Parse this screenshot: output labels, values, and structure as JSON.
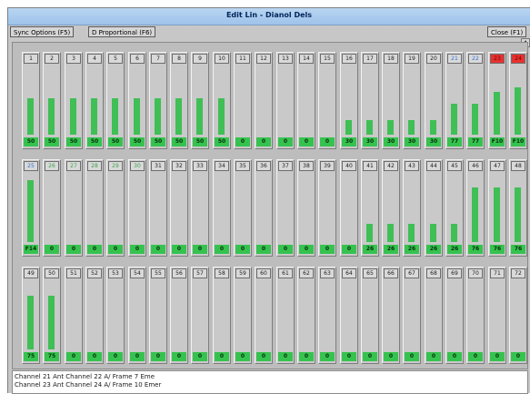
{
  "window": {
    "title": "Edit Lin - Dianol Dels"
  },
  "toolbar": {
    "left_button": "Sync Options (F5)",
    "middle_button": "D Proportional (F6)",
    "right_button": "Close (F1)",
    "scroll_glyph": "▲"
  },
  "colors": {
    "bar": "#3fbf55",
    "value_box": "#36c24f",
    "alarm": "#e5312e",
    "blue_label": "#2f6fd8",
    "green_label": "#3ca24b"
  },
  "channels": [
    {
      "label": "1",
      "value": "50",
      "level": 0.55,
      "label_color": "normal"
    },
    {
      "label": "2",
      "value": "50",
      "level": 0.55,
      "label_color": "normal"
    },
    {
      "label": "3",
      "value": "50",
      "level": 0.55,
      "label_color": "normal"
    },
    {
      "label": "4",
      "value": "50",
      "level": 0.55,
      "label_color": "normal"
    },
    {
      "label": "5",
      "value": "50",
      "level": 0.55,
      "label_color": "normal"
    },
    {
      "label": "6",
      "value": "50",
      "level": 0.55,
      "label_color": "normal"
    },
    {
      "label": "7",
      "value": "50",
      "level": 0.55,
      "label_color": "normal"
    },
    {
      "label": "8",
      "value": "50",
      "level": 0.55,
      "label_color": "normal"
    },
    {
      "label": "9",
      "value": "50",
      "level": 0.55,
      "label_color": "normal"
    },
    {
      "label": "10",
      "value": "50",
      "level": 0.55,
      "label_color": "normal"
    },
    {
      "label": "11",
      "value": "0",
      "level": 0,
      "label_color": "normal"
    },
    {
      "label": "12",
      "value": "0",
      "level": 0,
      "label_color": "normal"
    },
    {
      "label": "13",
      "value": "0",
      "level": 0,
      "label_color": "normal"
    },
    {
      "label": "14",
      "value": "0",
      "level": 0,
      "label_color": "normal"
    },
    {
      "label": "15",
      "value": "0",
      "level": 0,
      "label_color": "normal"
    },
    {
      "label": "16",
      "value": "30",
      "level": 0.22,
      "label_color": "normal"
    },
    {
      "label": "17",
      "value": "30",
      "level": 0.22,
      "label_color": "normal"
    },
    {
      "label": "18",
      "value": "30",
      "level": 0.22,
      "label_color": "normal"
    },
    {
      "label": "19",
      "value": "30",
      "level": 0.22,
      "label_color": "normal"
    },
    {
      "label": "20",
      "value": "30",
      "level": 0.22,
      "label_color": "normal"
    },
    {
      "label": "21",
      "value": "77",
      "level": 0.47,
      "label_color": "blue"
    },
    {
      "label": "22",
      "value": "77",
      "level": 0.47,
      "label_color": "blue"
    },
    {
      "label": "23",
      "value": "F10",
      "level": 0.65,
      "label_color": "red"
    },
    {
      "label": "24",
      "value": "F10",
      "level": 0.72,
      "label_color": "red"
    },
    {
      "label": "25",
      "value": "F14",
      "level": 0.95,
      "label_color": "blue"
    },
    {
      "label": "26",
      "value": "0",
      "level": 0,
      "label_color": "green"
    },
    {
      "label": "27",
      "value": "0",
      "level": 0,
      "label_color": "green"
    },
    {
      "label": "28",
      "value": "0",
      "level": 0,
      "label_color": "green"
    },
    {
      "label": "29",
      "value": "0",
      "level": 0,
      "label_color": "green"
    },
    {
      "label": "30",
      "value": "0",
      "level": 0,
      "label_color": "green"
    },
    {
      "label": "31",
      "value": "0",
      "level": 0,
      "label_color": "normal"
    },
    {
      "label": "32",
      "value": "0",
      "level": 0,
      "label_color": "normal"
    },
    {
      "label": "33",
      "value": "0",
      "level": 0,
      "label_color": "normal"
    },
    {
      "label": "34",
      "value": "0",
      "level": 0,
      "label_color": "normal"
    },
    {
      "label": "35",
      "value": "0",
      "level": 0,
      "label_color": "normal"
    },
    {
      "label": "36",
      "value": "0",
      "level": 0,
      "label_color": "normal"
    },
    {
      "label": "37",
      "value": "0",
      "level": 0,
      "label_color": "normal"
    },
    {
      "label": "38",
      "value": "0",
      "level": 0,
      "label_color": "normal"
    },
    {
      "label": "39",
      "value": "0",
      "level": 0,
      "label_color": "normal"
    },
    {
      "label": "40",
      "value": "0",
      "level": 0,
      "label_color": "normal"
    },
    {
      "label": "41",
      "value": "26",
      "level": 0.28,
      "label_color": "normal"
    },
    {
      "label": "42",
      "value": "26",
      "level": 0.28,
      "label_color": "normal"
    },
    {
      "label": "43",
      "value": "26",
      "level": 0.28,
      "label_color": "normal"
    },
    {
      "label": "44",
      "value": "26",
      "level": 0.28,
      "label_color": "normal"
    },
    {
      "label": "45",
      "value": "26",
      "level": 0.28,
      "label_color": "normal"
    },
    {
      "label": "46",
      "value": "76",
      "level": 0.83,
      "label_color": "normal"
    },
    {
      "label": "47",
      "value": "76",
      "level": 0.83,
      "label_color": "normal"
    },
    {
      "label": "48",
      "value": "76",
      "level": 0.83,
      "label_color": "normal"
    },
    {
      "label": "49",
      "value": "75",
      "level": 0.82,
      "label_color": "normal"
    },
    {
      "label": "50",
      "value": "75",
      "level": 0.82,
      "label_color": "normal"
    },
    {
      "label": "51",
      "value": "0",
      "level": 0,
      "label_color": "normal"
    },
    {
      "label": "52",
      "value": "0",
      "level": 0,
      "label_color": "normal"
    },
    {
      "label": "53",
      "value": "0",
      "level": 0,
      "label_color": "normal"
    },
    {
      "label": "54",
      "value": "0",
      "level": 0,
      "label_color": "normal"
    },
    {
      "label": "55",
      "value": "0",
      "level": 0,
      "label_color": "normal"
    },
    {
      "label": "56",
      "value": "0",
      "level": 0,
      "label_color": "normal"
    },
    {
      "label": "57",
      "value": "0",
      "level": 0,
      "label_color": "normal"
    },
    {
      "label": "58",
      "value": "0",
      "level": 0,
      "label_color": "normal"
    },
    {
      "label": "59",
      "value": "0",
      "level": 0,
      "label_color": "normal"
    },
    {
      "label": "60",
      "value": "0",
      "level": 0,
      "label_color": "normal"
    },
    {
      "label": "61",
      "value": "0",
      "level": 0,
      "label_color": "normal"
    },
    {
      "label": "62",
      "value": "0",
      "level": 0,
      "label_color": "normal"
    },
    {
      "label": "63",
      "value": "0",
      "level": 0,
      "label_color": "normal"
    },
    {
      "label": "64",
      "value": "0",
      "level": 0,
      "label_color": "normal"
    },
    {
      "label": "65",
      "value": "0",
      "level": 0,
      "label_color": "normal"
    },
    {
      "label": "66",
      "value": "0",
      "level": 0,
      "label_color": "normal"
    },
    {
      "label": "67",
      "value": "0",
      "level": 0,
      "label_color": "normal"
    },
    {
      "label": "68",
      "value": "0",
      "level": 0,
      "label_color": "normal"
    },
    {
      "label": "69",
      "value": "0",
      "level": 0,
      "label_color": "normal"
    },
    {
      "label": "70",
      "value": "0",
      "level": 0,
      "label_color": "normal"
    },
    {
      "label": "71",
      "value": "0",
      "level": 0,
      "label_color": "normal"
    },
    {
      "label": "72",
      "value": "0",
      "level": 0,
      "label_color": "normal"
    }
  ],
  "status": {
    "line1": "Channel 21 Ant Channel 22 A/ Frame 7 Eme",
    "line2": "Channel 23 Ant Channel 24 A/ Frame 10 Emer"
  }
}
